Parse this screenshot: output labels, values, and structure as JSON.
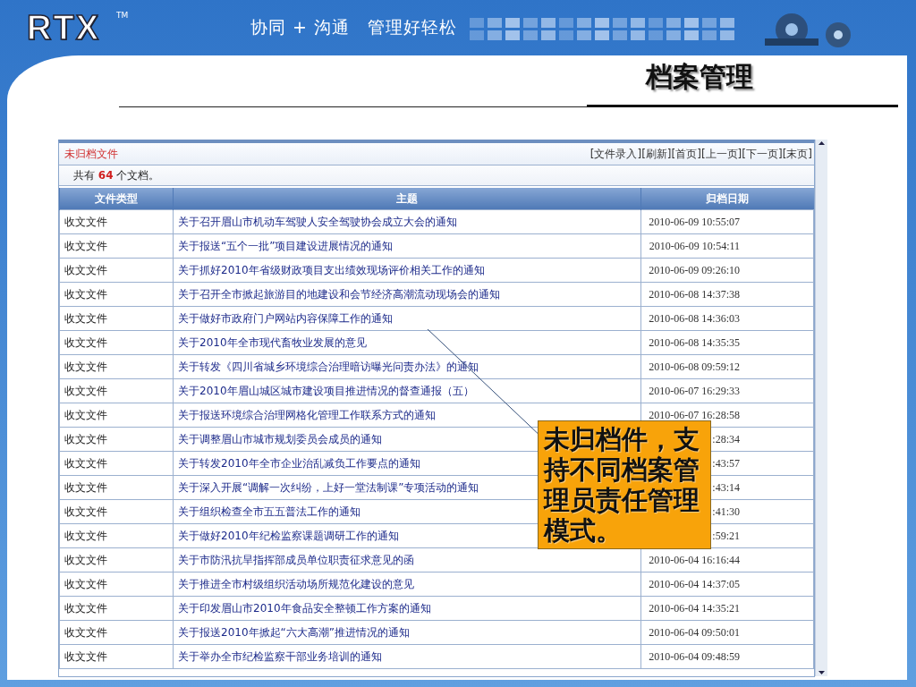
{
  "header": {
    "logo": "RTX",
    "trademark": "TM",
    "tagline": "协同 + 沟通　管理好轻松"
  },
  "slide_title": "档案管理",
  "panel": {
    "title": "未归档文件",
    "actions": [
      "[文件录入]",
      "[刷新]",
      "[首页]",
      "[上一页]",
      "[下一页]",
      "[末页]"
    ],
    "count_text": "共有 **64** 个文档。",
    "columns": [
      "文件类型",
      "主题",
      "归档日期"
    ],
    "rows": [
      {
        "type": "收文文件",
        "subject": "关于召开眉山市机动车驾驶人安全驾驶协会成立大会的通知",
        "date": "2010-06-09 10:55:07"
      },
      {
        "type": "收文文件",
        "subject": "关于报送“五个一批”项目建设进展情况的通知",
        "date": "2010-06-09 10:54:11"
      },
      {
        "type": "收文文件",
        "subject": "关于抓好2010年省级财政项目支出绩效现场评价相关工作的通知",
        "date": "2010-06-09 09:26:10"
      },
      {
        "type": "收文文件",
        "subject": "关于召开全市掀起旅游目的地建设和会节经济高潮流动现场会的通知",
        "date": "2010-06-08 14:37:38"
      },
      {
        "type": "收文文件",
        "subject": "关于做好市政府门户网站内容保障工作的通知",
        "date": "2010-06-08 14:36:03"
      },
      {
        "type": "收文文件",
        "subject": "关于2010年全市现代畜牧业发展的意见",
        "date": "2010-06-08 14:35:35"
      },
      {
        "type": "收文文件",
        "subject": "关于转发《四川省城乡环境综合治理暗访曝光问责办法》的通知",
        "date": "2010-06-08 09:59:12"
      },
      {
        "type": "收文文件",
        "subject": "关于2010年眉山城区城市建设项目推进情况的督查通报（五）",
        "date": "2010-06-07 16:29:33"
      },
      {
        "type": "收文文件",
        "subject": "关于报送环境综合治理网格化管理工作联系方式的通知",
        "date": "2010-06-07 16:28:58"
      },
      {
        "type": "收文文件",
        "subject": "关于调整眉山市城市规划委员会成员的通知",
        "date": ":28:34"
      },
      {
        "type": "收文文件",
        "subject": "关于转发2010年全市企业治乱减负工作要点的通知",
        "date": ":43:57"
      },
      {
        "type": "收文文件",
        "subject": "关于深入开展“调解一次纠纷，上好一堂法制课”专项活动的通知",
        "date": ":43:14"
      },
      {
        "type": "收文文件",
        "subject": "关于组织检查全市五五普法工作的通知",
        "date": ":41:30"
      },
      {
        "type": "收文文件",
        "subject": "关于做好2010年纪检监察课题调研工作的通知",
        "date": ":59:21"
      },
      {
        "type": "收文文件",
        "subject": "关于市防汛抗旱指挥部成员单位职责征求意见的函",
        "date": "2010-06-04 16:16:44"
      },
      {
        "type": "收文文件",
        "subject": "关于推进全市村级组织活动场所规范化建设的意见",
        "date": "2010-06-04 14:37:05"
      },
      {
        "type": "收文文件",
        "subject": "关于印发眉山市2010年食品安全整顿工作方案的通知",
        "date": "2010-06-04 14:35:21"
      },
      {
        "type": "收文文件",
        "subject": "关于报送2010年掀起“六大高潮”推进情况的通知",
        "date": "2010-06-04 09:50:01"
      },
      {
        "type": "收文文件",
        "subject": "关于举办全市纪检监察干部业务培训的通知",
        "date": "2010-06-04 09:48:59"
      }
    ]
  },
  "callout": "未归档件，支持不同档案管理员责任管理模式。"
}
